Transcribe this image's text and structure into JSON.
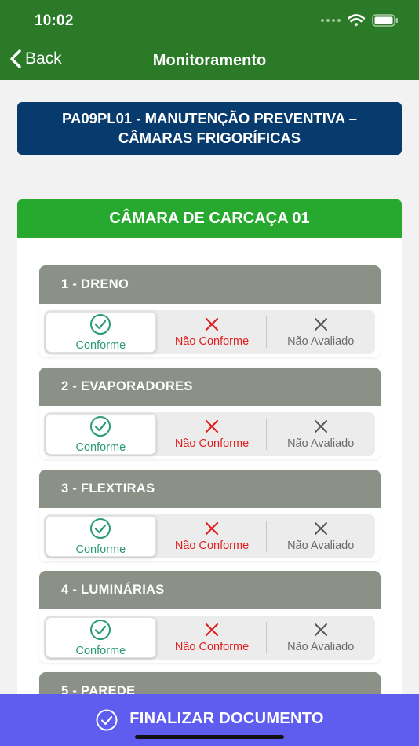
{
  "status_bar": {
    "time": "10:02"
  },
  "nav": {
    "back_label": "Back",
    "title": "Monitoramento"
  },
  "document": {
    "title": "PA09PL01 - MANUTENÇÃO PREVENTIVA – CÂMARAS FRIGORÍFICAS"
  },
  "section": {
    "title": "CÂMARA DE CARCAÇA 01"
  },
  "options": {
    "conforme": "Conforme",
    "nao_conforme": "Não Conforme",
    "nao_avaliado": "Não Avaliado"
  },
  "items": [
    {
      "label": "1 - DRENO",
      "selected": "Conforme"
    },
    {
      "label": "2 - EVAPORADORES",
      "selected": "Conforme"
    },
    {
      "label": "3 - FLEXTIRAS",
      "selected": "Conforme"
    },
    {
      "label": "4 - LUMINÁRIAS",
      "selected": "Conforme"
    },
    {
      "label": "5 - PAREDE"
    }
  ],
  "footer": {
    "finalize_label": "FINALIZAR DOCUMENTO"
  },
  "colors": {
    "header_green": "#2a7a27",
    "title_navy": "#073a6d",
    "section_green": "#27a82f",
    "item_gray": "#8b9186",
    "conforme_teal": "#2a9a74",
    "nao_conforme_red": "#e21f1f",
    "footer_indigo": "#5f5cf0"
  }
}
